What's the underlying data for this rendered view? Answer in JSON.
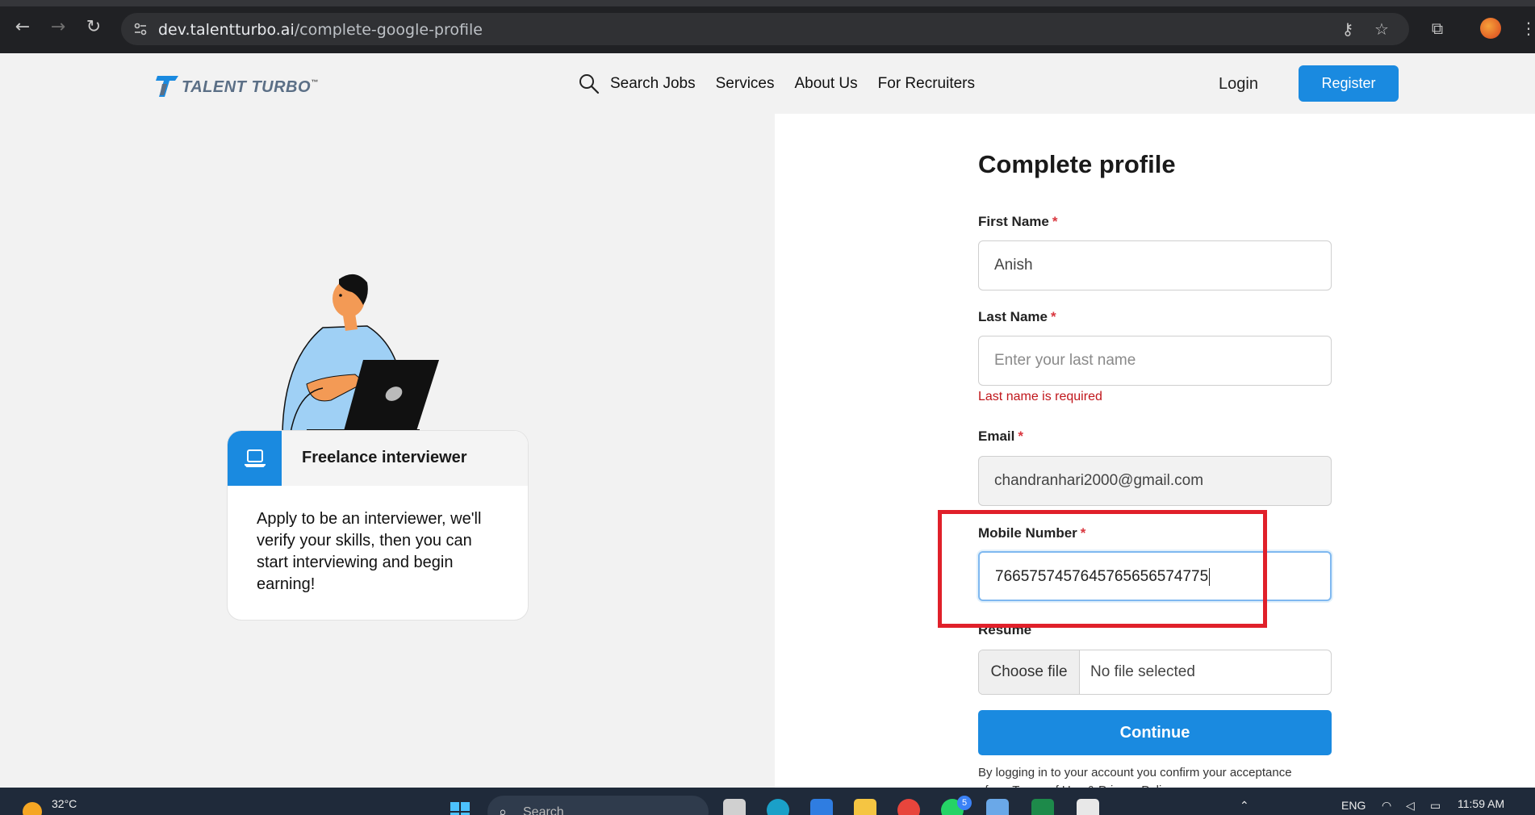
{
  "browser": {
    "url_host": "dev.talentturbo.ai",
    "url_path": "/complete-google-profile"
  },
  "site": {
    "logo_text": "TALENT TURBO",
    "logo_tm": "™",
    "nav": [
      "Search Jobs",
      "Services",
      "About Us",
      "For Recruiters"
    ],
    "login": "Login",
    "register": "Register"
  },
  "card": {
    "title": "Freelance interviewer",
    "body": "Apply to be an interviewer, we'll verify your skills, then you can start interviewing and begin earning!"
  },
  "form": {
    "title": "Complete profile",
    "first_name_label": "First Name",
    "first_name_value": "Anish",
    "last_name_label": "Last Name",
    "last_name_placeholder": "Enter your last name",
    "last_name_error": "Last name is required",
    "email_label": "Email",
    "email_value": "chandranhari2000@gmail.com",
    "mobile_label": "Mobile Number",
    "mobile_value": "766575745764576565657477",
    "mobile_value_tail": "5",
    "resume_label": "Resume",
    "file_button": "Choose file",
    "file_status": "No file selected",
    "required_mark": "*",
    "continue": "Continue",
    "terms_line1": "By logging in to your account you confirm your acceptance",
    "terms_line2": "of our Terms of Use & Privacy Policy"
  },
  "taskbar": {
    "temperature": "32°C",
    "search": "Search",
    "language": "ENG",
    "time": "11:59 AM",
    "notification_count": "5"
  },
  "colors": {
    "brand_blue": "#1a8ae0",
    "error_red": "#c0161b",
    "highlight_red": "#e0202a"
  }
}
